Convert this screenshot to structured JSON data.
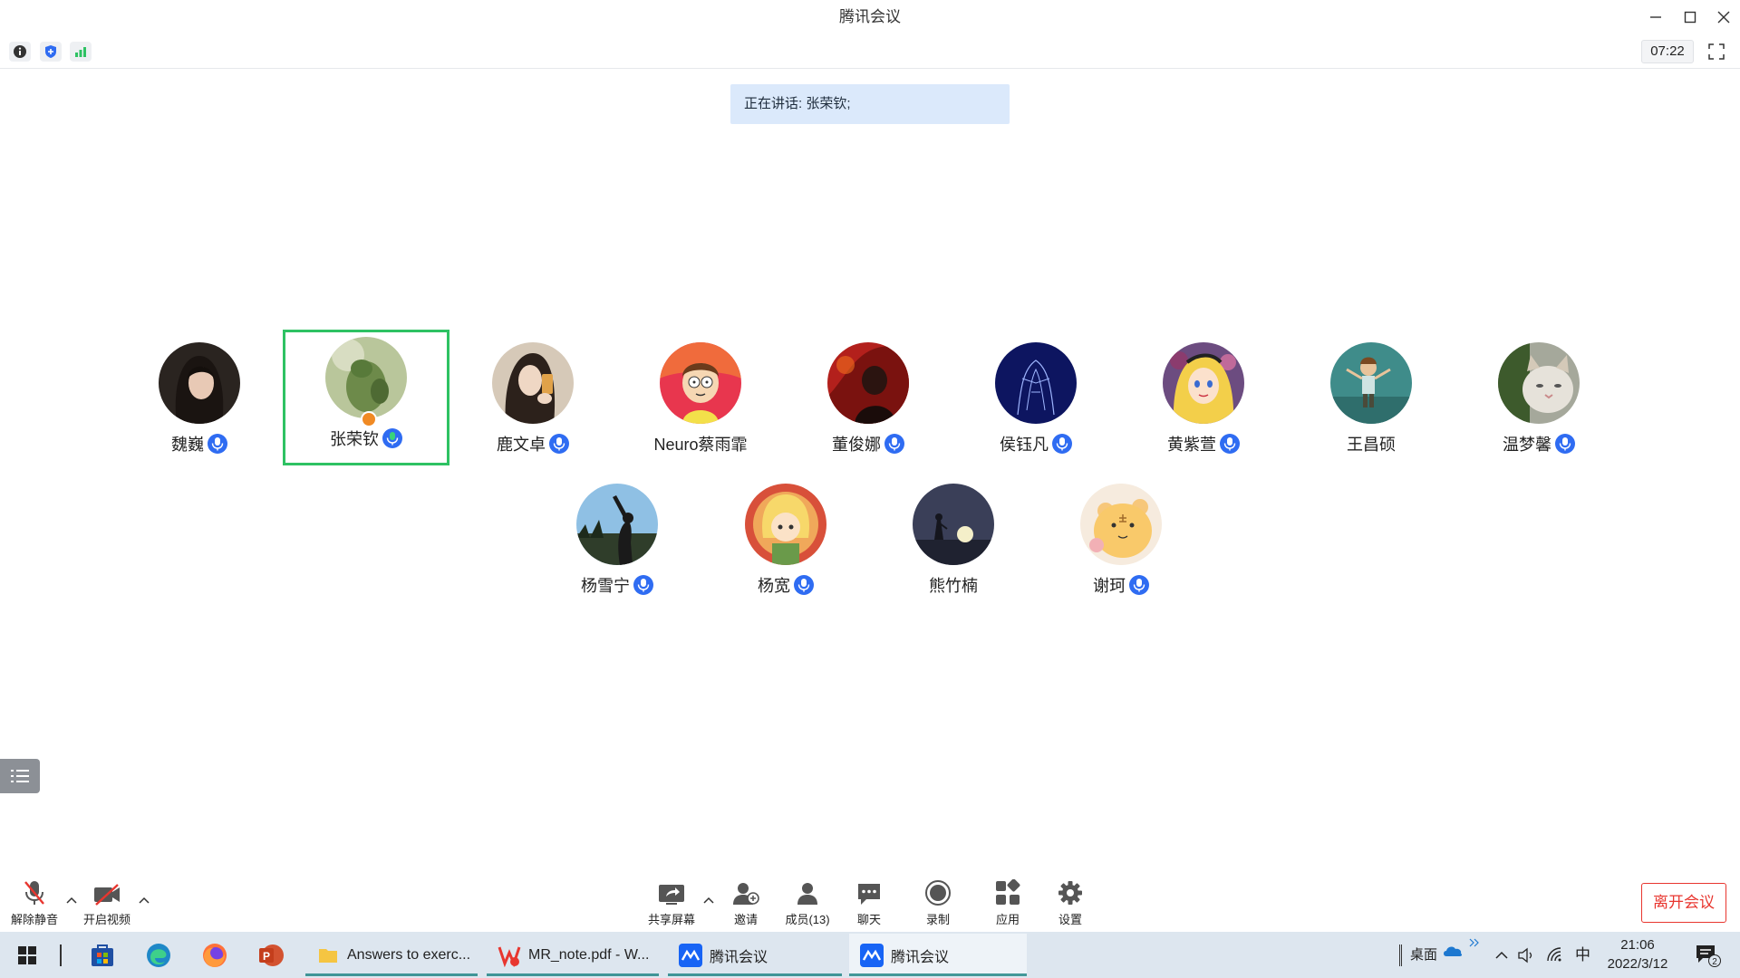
{
  "window": {
    "title": "腾讯会议"
  },
  "status": {
    "timer": "07:22"
  },
  "speaking": {
    "text": "正在讲话: 张荣钦;"
  },
  "participants": [
    {
      "name": "魏巍",
      "mic": true,
      "avatar": "woman-portrait"
    },
    {
      "name": "张荣钦",
      "mic": true,
      "host": true,
      "active": true,
      "avatar": "green-toy"
    },
    {
      "name": "鹿文卓",
      "mic": true,
      "avatar": "woman-selfie"
    },
    {
      "name": "Neuro蔡雨霏",
      "mic": false,
      "avatar": "cartoon-morty"
    },
    {
      "name": "董俊娜",
      "mic": true,
      "avatar": "red-portrait"
    },
    {
      "name": "侯钰凡",
      "mic": true,
      "avatar": "blue-drawing"
    },
    {
      "name": "黄紫萱",
      "mic": true,
      "avatar": "cartoon-alice"
    },
    {
      "name": "王昌硕",
      "mic": false,
      "avatar": "boy-teal"
    },
    {
      "name": "温梦馨",
      "mic": true,
      "avatar": "cat"
    },
    {
      "name": "杨雪宁",
      "mic": true,
      "avatar": "silhouette-sky"
    },
    {
      "name": "杨宽",
      "mic": true,
      "avatar": "cartoon-girl"
    },
    {
      "name": "熊竹楠",
      "mic": false,
      "avatar": "dusk-moon"
    },
    {
      "name": "谢珂",
      "mic": true,
      "avatar": "cartoon-bear"
    }
  ],
  "toolbar": {
    "unmute": "解除静音",
    "start_video": "开启视频",
    "share": "共享屏幕",
    "invite": "邀请",
    "members": "成员(13)",
    "chat": "聊天",
    "record": "录制",
    "apps": "应用",
    "settings": "设置",
    "leave": "离开会议"
  },
  "taskbar": {
    "apps": [
      {
        "label": "Answers to exerc...",
        "icon": "folder-icon"
      },
      {
        "label": "MR_note.pdf - W...",
        "icon": "wps-pdf-icon"
      },
      {
        "label": "腾讯会议",
        "icon": "tencent-meeting-icon"
      },
      {
        "label": "腾讯会议",
        "icon": "tencent-meeting-icon"
      }
    ],
    "desktop": "桌面",
    "ime": "中",
    "time": "21:06",
    "date": "2022/3/12",
    "notifications": "2"
  },
  "colors": {
    "accent": "#2f6cf2",
    "active_border": "#2ec263",
    "leave": "#e8362f",
    "banner": "#dbe9fb"
  }
}
